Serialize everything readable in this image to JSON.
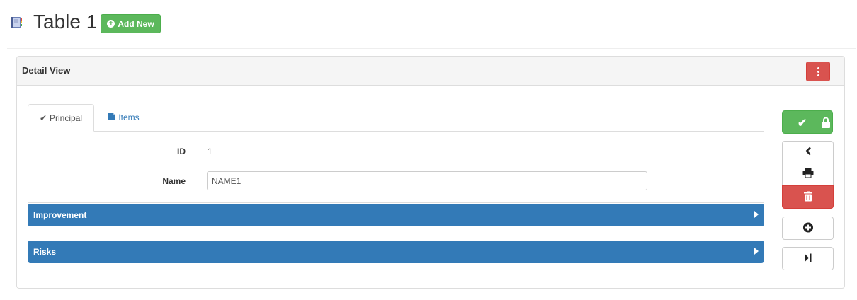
{
  "header": {
    "title": "Table 1",
    "add_new_label": "Add New",
    "title_icon": "book-icon"
  },
  "panel": {
    "title": "Detail View",
    "menu_icon": "vertical-ellipsis-icon"
  },
  "tabs": [
    {
      "label": "Principal",
      "icon": "check-icon",
      "active": true
    },
    {
      "label": "Items",
      "icon": "file-icon",
      "active": false
    }
  ],
  "form": {
    "id_label": "ID",
    "id_value": "1",
    "name_label": "Name",
    "name_value": "NAME1"
  },
  "sections": [
    {
      "label": "Improvement"
    },
    {
      "label": "Risks"
    }
  ],
  "actions": {
    "save_icons": [
      "check-icon",
      "lock-icon"
    ],
    "back_icon": "chevron-left-icon",
    "print_icon": "print-icon",
    "delete_icon": "trash-icon",
    "add_icon": "plus-circle-icon",
    "last_icon": "step-forward-icon"
  },
  "colors": {
    "success": "#5cb85c",
    "danger": "#d9534f",
    "primary": "#337ab7"
  }
}
